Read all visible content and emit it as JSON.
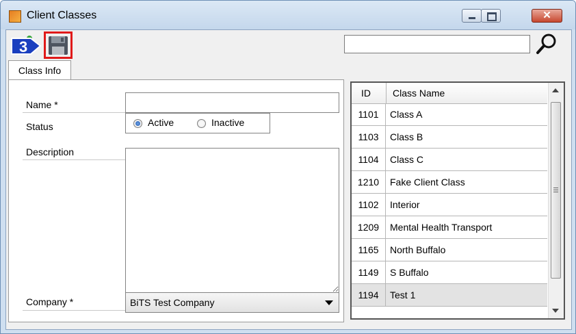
{
  "window": {
    "title": "Client Classes",
    "buttons": {
      "minimize": "minimize",
      "maximize": "maximize",
      "close": "✕"
    }
  },
  "toolbar": {
    "step_number": "3",
    "save_icon": "floppy-disk-icon",
    "search": {
      "value": "",
      "icon": "magnifier-icon"
    }
  },
  "tabs": [
    {
      "label": "Class Info",
      "active": true
    }
  ],
  "form": {
    "name_label": "Name *",
    "name_value": "",
    "status_label": "Status",
    "status_options": [
      {
        "label": "Active",
        "checked": true
      },
      {
        "label": "Inactive",
        "checked": false
      }
    ],
    "description_label": "Description",
    "description_value": "",
    "company_label": "Company *",
    "company_value": "BiTS Test Company"
  },
  "grid": {
    "columns": [
      "ID",
      "Class Name"
    ],
    "rows": [
      {
        "id": "1101",
        "name": "Class A"
      },
      {
        "id": "1103",
        "name": "Class B"
      },
      {
        "id": "1104",
        "name": "Class C"
      },
      {
        "id": "1210",
        "name": "Fake Client Class"
      },
      {
        "id": "1102",
        "name": "Interior"
      },
      {
        "id": "1209",
        "name": "Mental Health Transport"
      },
      {
        "id": "1165",
        "name": "North Buffalo"
      },
      {
        "id": "1149",
        "name": "S Buffalo"
      },
      {
        "id": "1194",
        "name": "Test 1"
      }
    ],
    "selected_row": 8
  },
  "colors": {
    "highlight_border": "#e01919",
    "badge_blue": "#1a3fbf"
  }
}
